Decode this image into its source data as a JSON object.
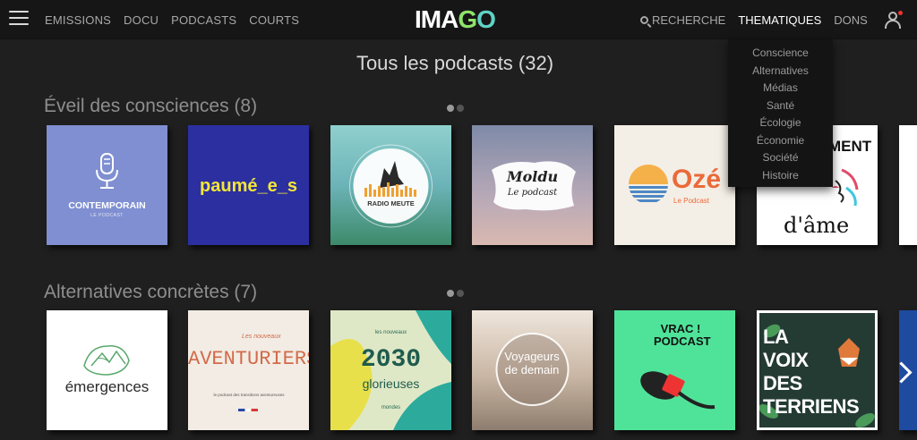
{
  "header": {
    "nav_left": [
      "EMISSIONS",
      "DOCU",
      "PODCASTS",
      "COURTS"
    ],
    "logo": "IMAGO",
    "search_label": "RECHERCHE",
    "thematiques_label": "THEMATIQUES",
    "dons_label": "DONS"
  },
  "dropdown": {
    "items": [
      "Conscience",
      "Alternatives",
      "Médias",
      "Santé",
      "Écologie",
      "Économie",
      "Société",
      "Histoire"
    ]
  },
  "page_title": "Tous les podcasts (32)",
  "sections": [
    {
      "title": "Éveil des consciences (8)",
      "tiles": [
        {
          "title": "CONTEMPORAIN",
          "subtitle": "LE PODCAST",
          "bg": "#7f8fd1"
        },
        {
          "title": "paumé_e_s",
          "bg": "#2b2fa0"
        },
        {
          "title": "RADIO MEUTE",
          "bg": "#5aa7a9"
        },
        {
          "title": "Moldu",
          "subtitle": "Le podcast",
          "bg": "#8d8fa8"
        },
        {
          "title": "Ozé",
          "subtitle": "Le Podcast",
          "bg": "#f4efe6"
        },
        {
          "title": "MENT",
          "subtitle": "d'âme",
          "bg": "#ffffff"
        }
      ]
    },
    {
      "title": "Alternatives concrètes (7)",
      "tiles": [
        {
          "title": "émergences",
          "bg": "#ffffff"
        },
        {
          "title": "AVENTURIERS",
          "subtitle": "le podcast des transitions aventureuses",
          "top": "Les nouveaux",
          "bg": "#f2ece4"
        },
        {
          "title": "2030",
          "subtitle": "glorieuses",
          "top": "les nouveaux",
          "bottom": "mondes",
          "bg": "#dfe8c6"
        },
        {
          "title": "Voyageurs de demain",
          "bg": "#b8a99a"
        },
        {
          "title": "VRAC ! PODCAST",
          "bg": "#4fe39a"
        },
        {
          "title": "LA VOIX DES TERRIENS",
          "bg": "#243b34"
        }
      ]
    }
  ]
}
